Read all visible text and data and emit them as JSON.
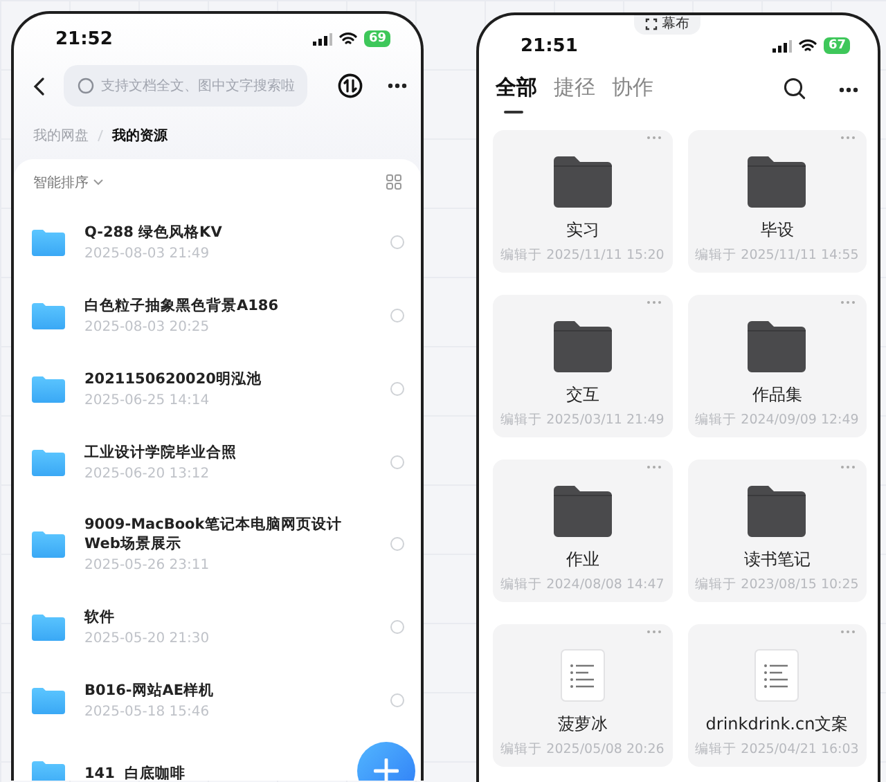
{
  "left_screen": {
    "status_bar": {
      "time": "21:52",
      "battery": "69"
    },
    "search": {
      "placeholder": "支持文档全文、图中文字搜索啦"
    },
    "breadcrumb": [
      {
        "label": "我的网盘",
        "selected": false
      },
      {
        "label": "我的资源",
        "selected": true
      }
    ],
    "sort": {
      "label": "智能排序"
    },
    "files": [
      {
        "name": "Q-288 绿色风格KV",
        "date": "2025-08-03 21:49",
        "selected": false
      },
      {
        "name": "白色粒子抽象黑色背景A186",
        "date": "2025-08-03 20:25",
        "selected": false
      },
      {
        "name": "2021150620020明泓池",
        "date": "2025-06-25 14:14",
        "selected": false
      },
      {
        "name": "工业设计学院毕业合照",
        "date": "2025-06-20 13:12",
        "selected": false
      },
      {
        "name": "9009-MacBook笔记本电脑网页设计Web场景展示",
        "date": "2025-05-26 23:11",
        "selected": false
      },
      {
        "name": "软件",
        "date": "2025-05-20 21:30",
        "selected": false
      },
      {
        "name": "B016-网站AE样机",
        "date": "2025-05-18 15:46",
        "selected": false
      },
      {
        "name": "141  白底咖啡"
      }
    ]
  },
  "right_screen": {
    "status_bar": {
      "time": "21:51",
      "battery": "67"
    },
    "island": {
      "label": "幕布"
    },
    "tabs": [
      {
        "label": "全部",
        "selected": true
      },
      {
        "label": "捷径",
        "selected": false
      },
      {
        "label": "协作",
        "selected": false
      }
    ],
    "items": [
      {
        "kind": "folder",
        "name": "实习",
        "edited": "编辑于 2025/11/11 15:20"
      },
      {
        "kind": "folder",
        "name": "毕设",
        "edited": "编辑于 2025/11/11 14:55"
      },
      {
        "kind": "folder",
        "name": "交互",
        "edited": "编辑于 2025/03/11 21:49"
      },
      {
        "kind": "folder",
        "name": "作品集",
        "edited": "编辑于 2024/09/09 12:49"
      },
      {
        "kind": "folder",
        "name": "作业",
        "edited": "编辑于 2024/08/08 14:47"
      },
      {
        "kind": "folder",
        "name": "读书笔记",
        "edited": "编辑于 2023/08/15 10:25"
      },
      {
        "kind": "doc",
        "name": "菠萝冰",
        "edited": "编辑于 2025/05/08 20:26"
      },
      {
        "kind": "doc",
        "name": "drinkdrink.cn文案",
        "edited": "编辑于 2025/04/21 16:03"
      }
    ]
  }
}
